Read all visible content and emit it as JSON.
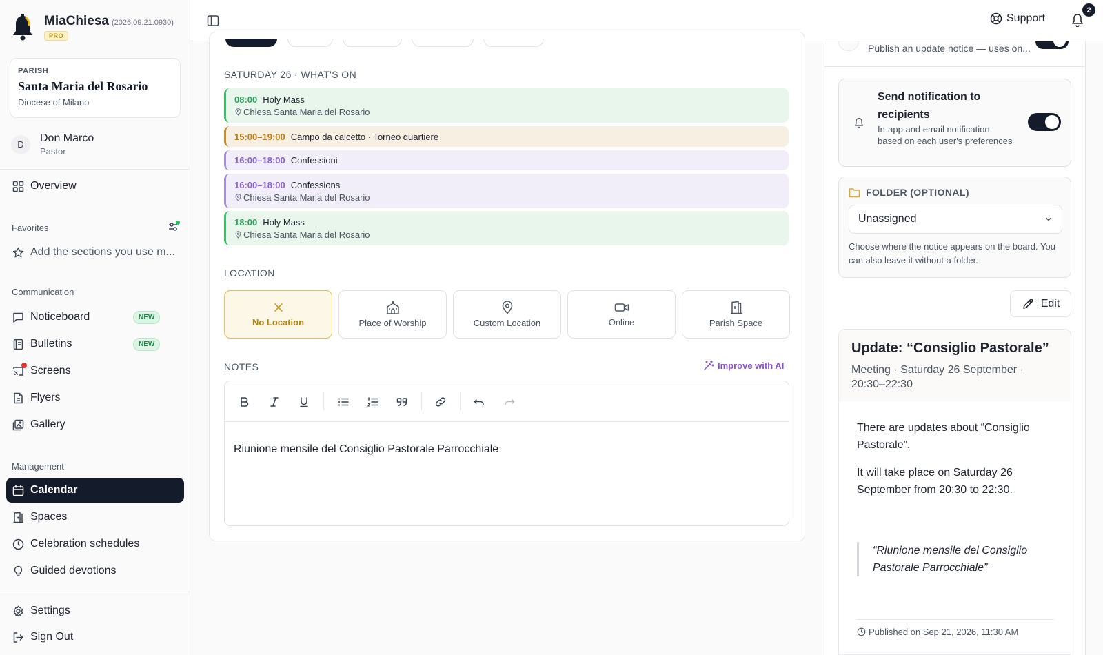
{
  "app": {
    "name": "MiaChiesa",
    "version": "(2026.09.21.0930)",
    "plan_badge": "PRO"
  },
  "parish": {
    "kicker": "PARISH",
    "name": "Santa Maria del Rosario",
    "diocese": "Diocese of Milano"
  },
  "user": {
    "initial": "D",
    "name": "Don Marco",
    "role": "Pastor"
  },
  "sidebar": {
    "overview": "Overview",
    "favorites_title": "Favorites",
    "favorites_add": "Add the sections you use m...",
    "communication_title": "Communication",
    "communication": [
      {
        "label": "Noticeboard",
        "badge": "NEW"
      },
      {
        "label": "Bulletins",
        "badge": "NEW"
      },
      {
        "label": "Screens"
      },
      {
        "label": "Flyers"
      },
      {
        "label": "Gallery"
      }
    ],
    "management_title": "Management",
    "management": [
      {
        "label": "Calendar"
      },
      {
        "label": "Spaces"
      },
      {
        "label": "Celebration schedules"
      },
      {
        "label": "Guided devotions"
      }
    ],
    "settings": "Settings",
    "sign_out": "Sign Out"
  },
  "header": {
    "support": "Support",
    "notifications_count": "2"
  },
  "schedule": {
    "title": "SATURDAY 26 · WHAT'S ON",
    "events": [
      {
        "time": "08:00",
        "title": "Holy Mass",
        "location": "Chiesa Santa Maria del Rosario",
        "color": "#3cc06a"
      },
      {
        "time": "15:00–19:00",
        "title": "Campo da calcetto · Torneo quartiere",
        "color": "#c98a2a"
      },
      {
        "time": "16:00–18:00",
        "title": "Confessioni",
        "color": "#a58be0"
      },
      {
        "time": "16:00–18:00",
        "title": "Confessions",
        "location": "Chiesa Santa Maria del Rosario",
        "color": "#a58be0"
      },
      {
        "time": "18:00",
        "title": "Holy Mass",
        "location": "Chiesa Santa Maria del Rosario",
        "color": "#3cc06a"
      }
    ]
  },
  "location": {
    "title": "LOCATION",
    "options": [
      {
        "label": "No Location",
        "icon": "x-icon",
        "selected": true
      },
      {
        "label": "Place of Worship",
        "icon": "church-icon"
      },
      {
        "label": "Custom Location",
        "icon": "map-pin-icon"
      },
      {
        "label": "Online",
        "icon": "video-icon"
      },
      {
        "label": "Parish Space",
        "icon": "door-icon"
      }
    ]
  },
  "notes": {
    "title": "NOTES",
    "improve": "Improve with AI",
    "content": "Riunione mensile del Consiglio Pastorale Parrocchiale"
  },
  "right_panel": {
    "publish_subtitle": "Publish an update notice — uses on...",
    "notify": {
      "title": "Send notification to recipients",
      "subtitle": "In-app and email notification based on each user's preferences",
      "enabled": true
    },
    "folder": {
      "label": "FOLDER (OPTIONAL)",
      "selected": "Unassigned",
      "help": "Choose where the notice appears on the board. You can also leave it without a folder."
    },
    "edit_label": "Edit",
    "preview": {
      "title": "Update: “Consiglio Pastorale”",
      "meta": "Meeting · Saturday 26 September · 20:30–22:30",
      "p1": "There are updates about “Consiglio Pastorale”.",
      "p2": "It will take place on Saturday 26 September from 20:30 to 22:30.",
      "quote": "“Riunione mensile del Consiglio Pastorale Parrocchiale”",
      "published": "Published on Sep 21, 2026, 11:30 AM"
    }
  },
  "colors": {
    "primary": "#141c2c",
    "accent_gold": "#e9bd55",
    "ai_purple": "#8a4fd8"
  }
}
